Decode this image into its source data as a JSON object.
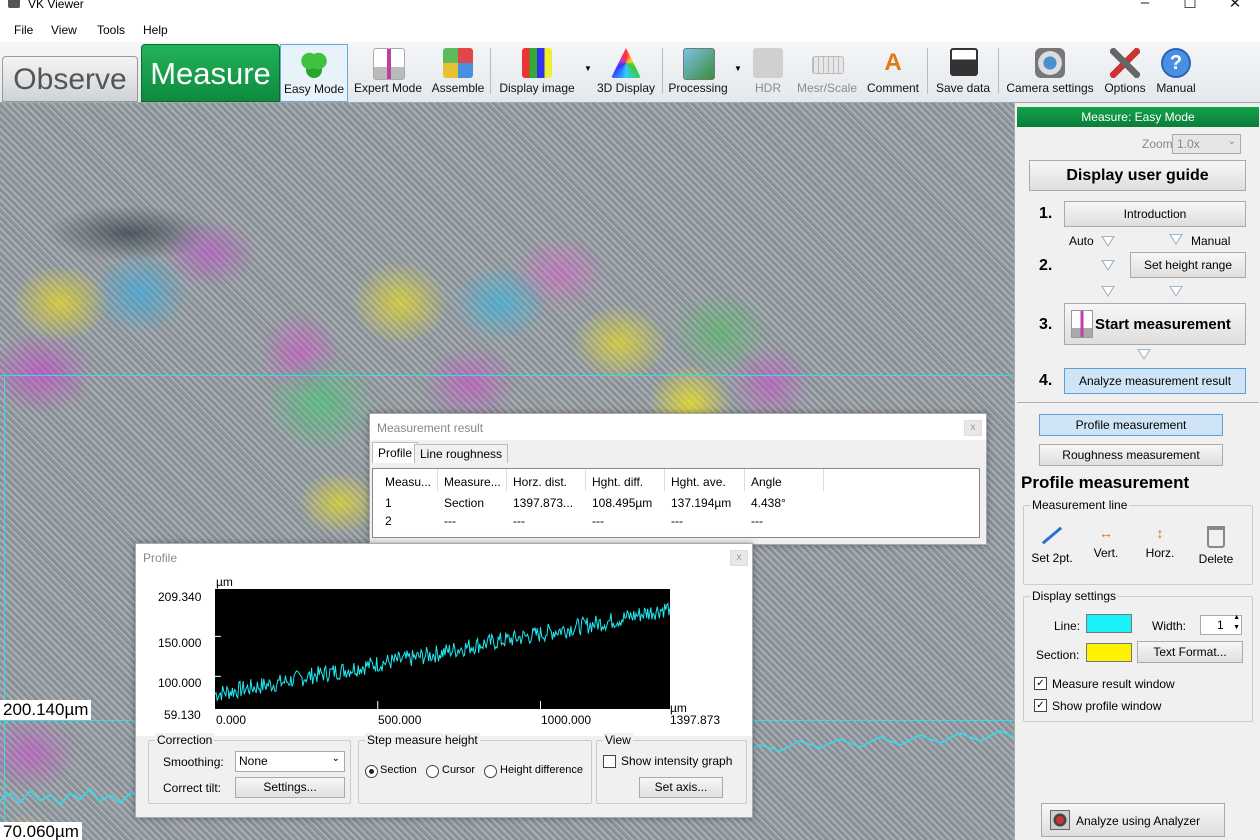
{
  "window": {
    "title": "VK Viewer"
  },
  "menu": [
    "File",
    "View",
    "Tools",
    "Help"
  ],
  "toolbar": {
    "observe_label": "Observe",
    "measure_label": "Measure",
    "buttons": [
      {
        "label": "Easy Mode",
        "icon": "clover-icon"
      },
      {
        "label": "Expert Mode",
        "icon": "measure-probe-icon"
      },
      {
        "label": "Assemble",
        "icon": "assemble-icon"
      },
      {
        "label": "Display image",
        "icon": "display-image-icon"
      },
      {
        "label": "3D Display",
        "icon": "3d-display-icon"
      },
      {
        "label": "Processing",
        "icon": "processing-icon"
      },
      {
        "label": "HDR",
        "icon": "hdr-icon"
      },
      {
        "label": "Mesr/Scale",
        "icon": "scale-icon"
      },
      {
        "label": "Comment",
        "icon": "comment-icon"
      },
      {
        "label": "Save data",
        "icon": "save-icon"
      },
      {
        "label": "Camera settings",
        "icon": "camera-icon"
      },
      {
        "label": "Options",
        "icon": "tools-icon"
      },
      {
        "label": "Manual",
        "icon": "help-icon"
      }
    ]
  },
  "image": {
    "scale_top": "200.140µm",
    "scale_bottom": "70.060µm",
    "line_color": "#29e0f0"
  },
  "measurement_result": {
    "title": "Measurement result",
    "tabs": [
      "Profile",
      "Line roughness"
    ],
    "columns": [
      "Measu...",
      "Measure...",
      "Horz. dist.",
      "Hght. diff.",
      "Hght. ave.",
      "Angle"
    ],
    "rows": [
      [
        "1",
        "Section",
        "1397.873...",
        "108.495µm",
        "137.194µm",
        "4.438°"
      ],
      [
        "2",
        "---",
        "---",
        "---",
        "---",
        "---"
      ]
    ],
    "close": "x"
  },
  "profile": {
    "title": "Profile",
    "close": "x",
    "unit": "µm",
    "y_ticks": [
      "209.340",
      "150.000",
      "100.000",
      "59.130"
    ],
    "x_ticks": [
      "0.000",
      "500.000",
      "1000.000",
      "1397.873"
    ],
    "x_unit": "µm",
    "correction": {
      "label": "Correction",
      "smoothing_label": "Smoothing:",
      "smoothing_value": "None",
      "tilt_label": "Correct tilt:",
      "settings_button": "Settings..."
    },
    "step": {
      "label": "Step measure height",
      "options": [
        "Section",
        "Cursor",
        "Height difference"
      ],
      "selected": "Section"
    },
    "view": {
      "label": "View",
      "intensity_label": "Show intensity graph",
      "intensity_checked": false,
      "axis_button": "Set axis..."
    }
  },
  "chart_data": {
    "type": "line",
    "xlabel": "µm",
    "ylabel": "µm",
    "xlim": [
      0,
      1397.873
    ],
    "ylim": [
      59.13,
      209.34
    ],
    "series": [
      {
        "x": [
          0,
          100,
          200,
          300,
          400,
          500,
          600,
          700,
          800,
          900,
          1000,
          1100,
          1200,
          1300,
          1397.873
        ],
        "values": [
          78,
          85,
          92,
          101,
          108,
          116,
          122,
          130,
          139,
          146,
          153,
          161,
          168,
          177,
          186
        ]
      }
    ],
    "line_color": "#22e8f0",
    "background": "#000000"
  },
  "panel": {
    "header": "Measure: Easy Mode",
    "zoom_label": "Zoom:",
    "zoom_value": "1.0x",
    "user_guide": "Display user guide",
    "steps": [
      "1.",
      "2.",
      "3.",
      "4."
    ],
    "introduction": "Introduction",
    "auto": "Auto",
    "manual": "Manual",
    "set_height_range": "Set height range",
    "start_measurement": "Start measurement",
    "analyze_result": "Analyze measurement result",
    "profile_measurement_btn": "Profile measurement",
    "roughness_measurement_btn": "Roughness measurement",
    "section_title": "Profile measurement",
    "measurement_line_label": "Measurement line",
    "line_tools": [
      {
        "label": "Set 2pt.",
        "icon": "set-two-point-icon"
      },
      {
        "label": "Vert.",
        "icon": "vertical-line-icon"
      },
      {
        "label": "Horz.",
        "icon": "horizontal-line-icon"
      },
      {
        "label": "Delete",
        "icon": "trash-icon"
      }
    ],
    "display_settings_label": "Display settings",
    "line_label": "Line:",
    "line_color": "#19f0f8",
    "width_label": "Width:",
    "width_value": "1",
    "section_label": "Section:",
    "section_color": "#fff200",
    "text_format": "Text Format...",
    "measure_result_window": "Measure result window",
    "show_profile_window": "Show profile window",
    "analyze_using_analyzer": "Analyze using Analyzer"
  }
}
